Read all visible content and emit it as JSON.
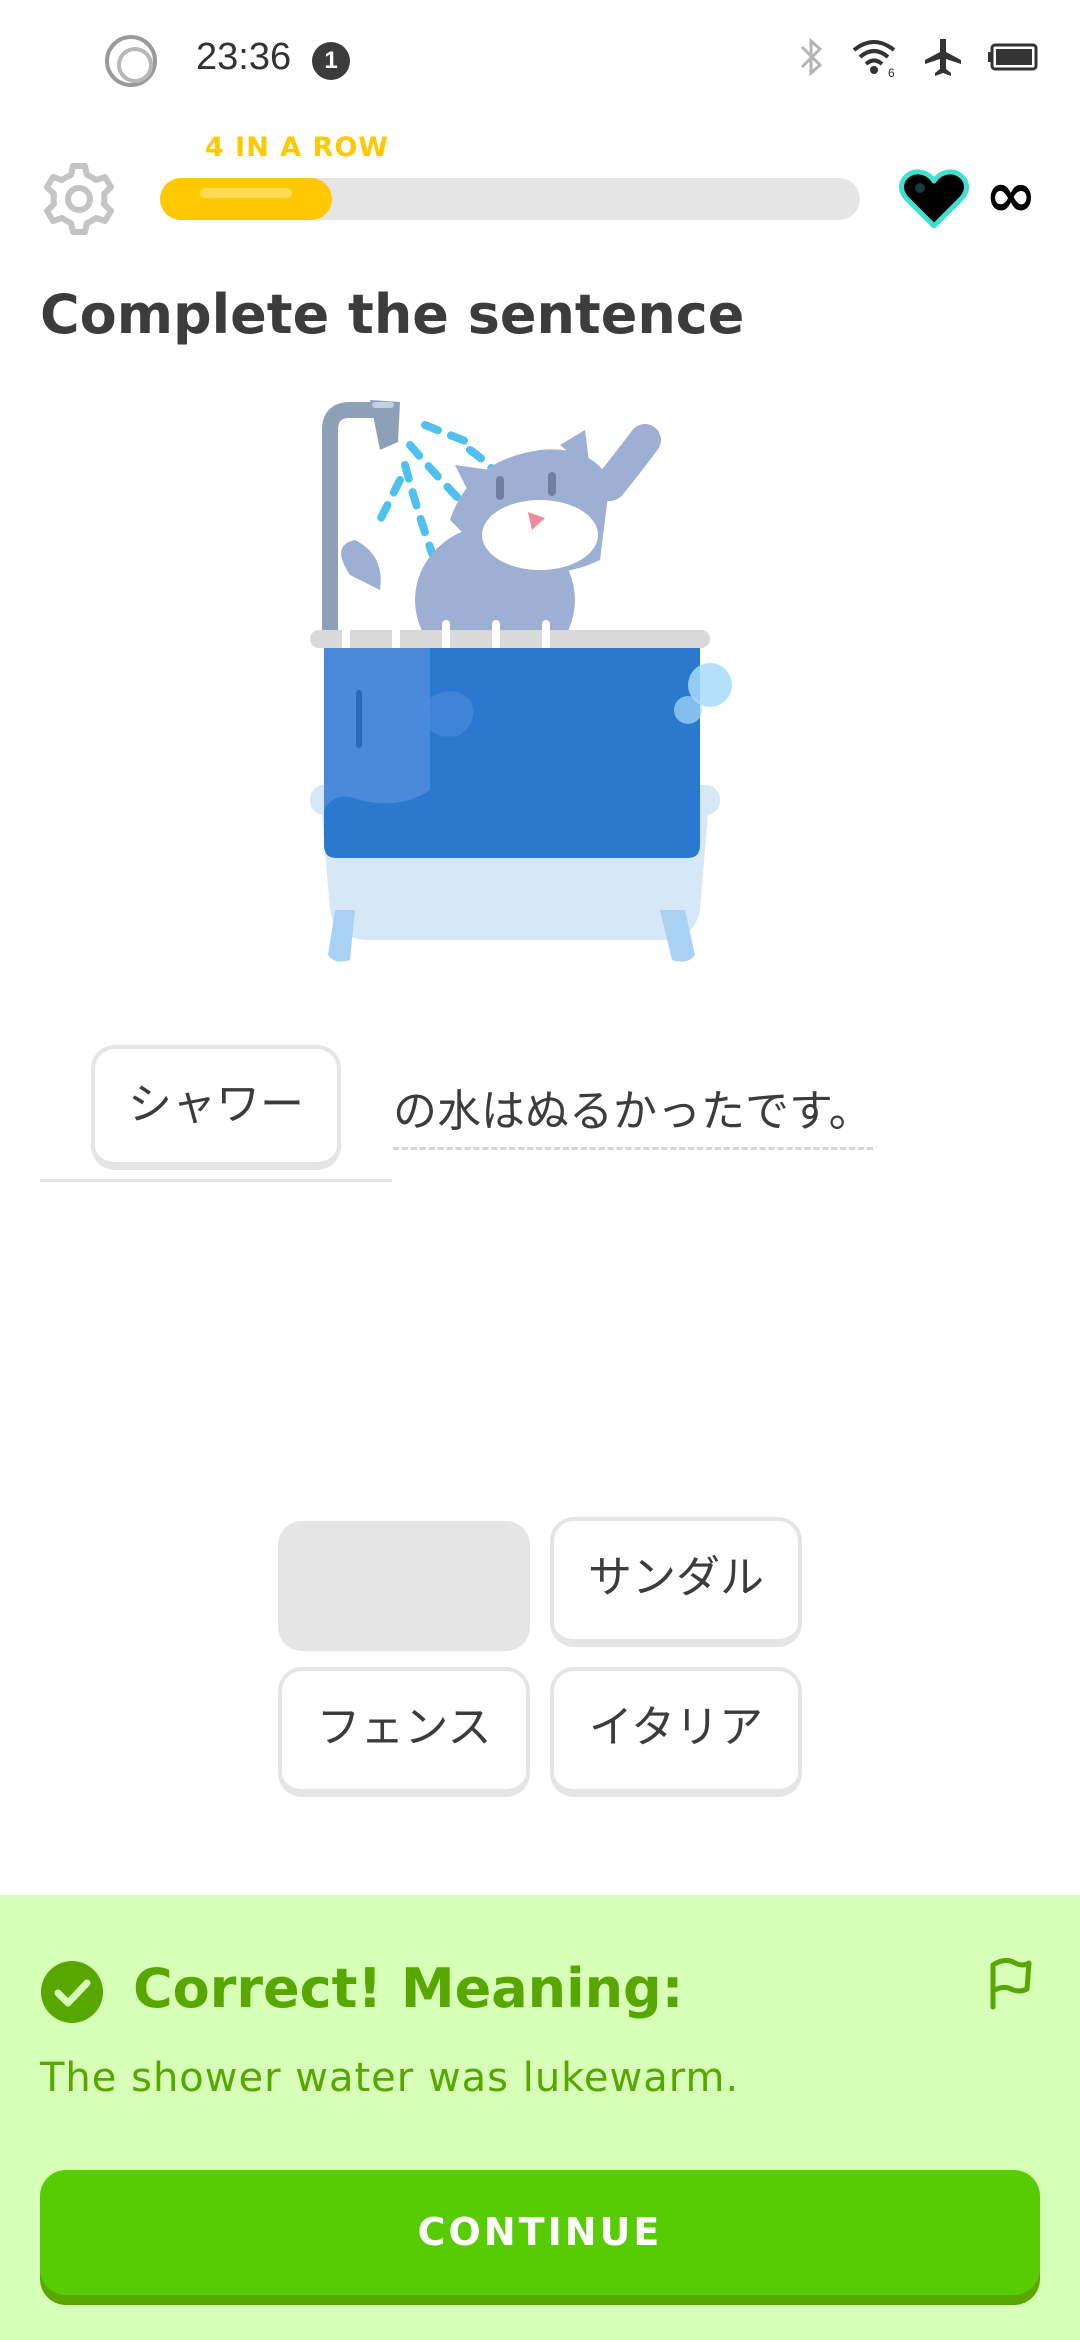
{
  "status_bar": {
    "time": "23:36",
    "notification_count": "1",
    "wifi_badge": "6",
    "icons": [
      "record-icon",
      "bluetooth-icon",
      "wifi-icon",
      "airplane-icon",
      "battery-icon"
    ]
  },
  "header": {
    "settings_icon": "gear-icon",
    "streak_label": "4 IN A ROW",
    "progress_fraction": 0.245,
    "hearts_icon": "heart-icon",
    "hearts_value": "∞"
  },
  "exercise": {
    "title": "Complete the sentence",
    "illustration": "cat-in-shower-illustration",
    "selected_word": "シャワー",
    "sentence_rest": "の水はぬるかったです。"
  },
  "word_bank": [
    {
      "label": "",
      "used": true
    },
    {
      "label": "サンダル",
      "used": false
    },
    {
      "label": "フェンス",
      "used": false
    },
    {
      "label": "イタリア",
      "used": false
    }
  ],
  "feedback": {
    "title": "Correct! Meaning:",
    "translation": "The shower water was lukewarm.",
    "check_icon": "checkmark-circle-icon",
    "report_icon": "flag-icon",
    "continue_label": "CONTINUE"
  },
  "colors": {
    "streak": "#ffc800",
    "success_bg": "#d7ffb8",
    "success_text": "#58a700",
    "button": "#58cc02",
    "heart_outline": "#3fe0d0"
  }
}
